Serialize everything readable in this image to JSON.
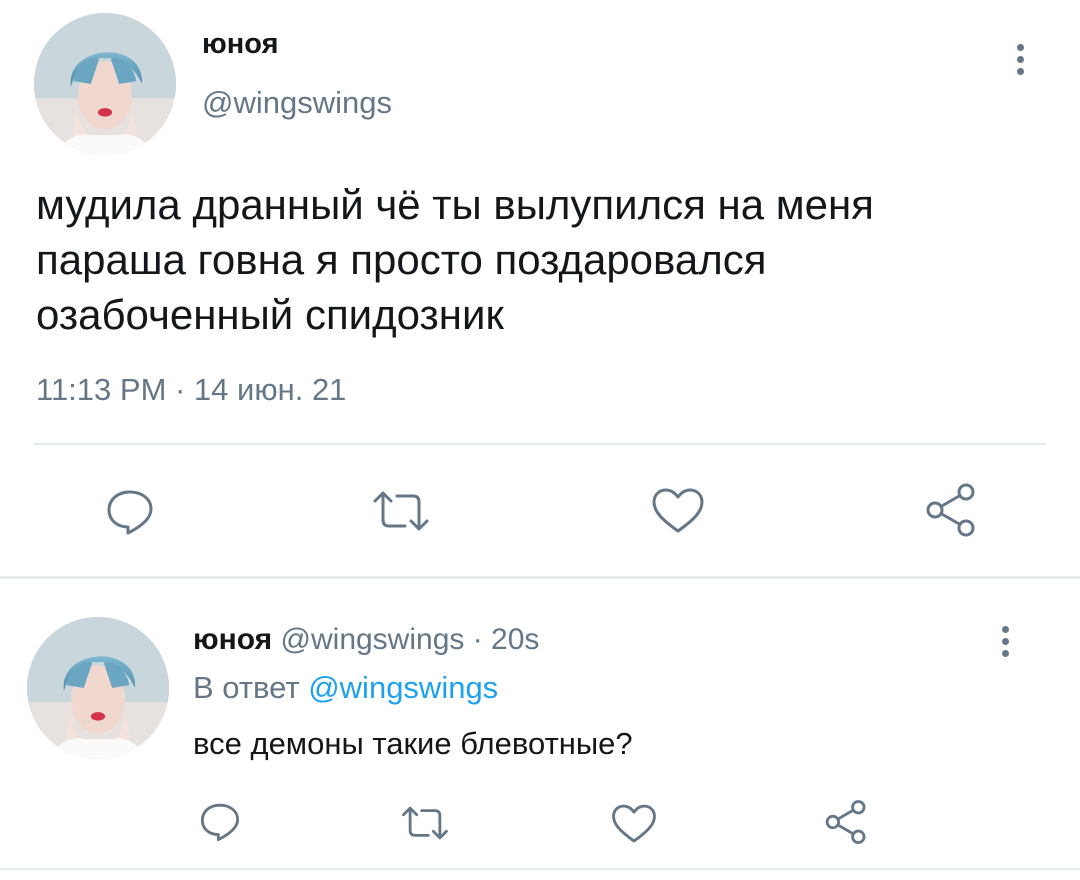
{
  "main_tweet": {
    "display_name": "юноя",
    "handle": "@wingswings",
    "text_lines": [
      "мудила дранный чё ты вылупился на меня",
      "параша говна я просто поздаровался",
      "озабоченный спидозник"
    ],
    "timestamp": "11:13 PM · 14 июн. 21",
    "actions": {
      "reply_icon": "reply-bubble-icon",
      "retweet_icon": "retweet-icon",
      "like_icon": "heart-icon",
      "share_icon": "share-icon"
    },
    "more_icon": "more-vertical-icon"
  },
  "reply_tweet": {
    "display_name": "юноя",
    "meta": "@wingswings · 20s",
    "reply_to_prefix": "В ответ",
    "reply_to_handle": "@wingswings",
    "text": "все демоны такие блевотные?",
    "more_icon": "more-vertical-icon"
  },
  "colors": {
    "text_primary": "#14171a",
    "text_secondary": "#657786",
    "link": "#1da1f2",
    "divider": "#e6ecf0"
  }
}
